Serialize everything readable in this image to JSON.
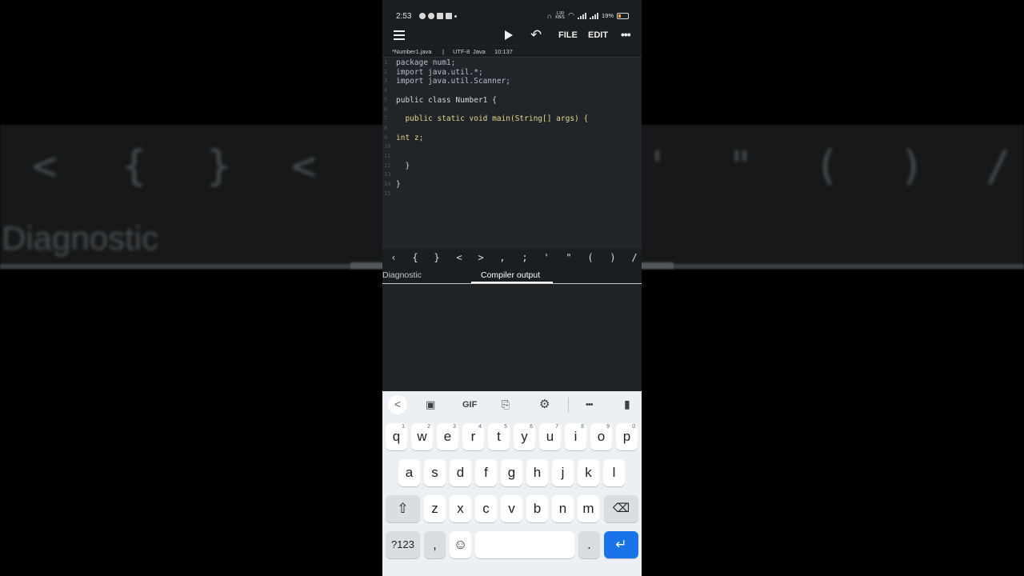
{
  "background": {
    "keys": [
      "<",
      "{",
      "}",
      "<",
      "'",
      "\"",
      "(",
      ")",
      "/"
    ],
    "diagnostic_label": "Diagnostic"
  },
  "status_bar": {
    "time": "2:53",
    "network_speed": "1.00 KB/S",
    "battery": "19%"
  },
  "toolbar": {
    "file_label": "FILE",
    "edit_label": "EDIT",
    "more_label": "•••",
    "undo_glyph": "↶"
  },
  "file_info": {
    "filename": "*Number1.java",
    "separator": "|",
    "encoding": "UTF-8",
    "language": "Java",
    "cursor": "10:137"
  },
  "editor": {
    "lines": [
      {
        "num": "1",
        "code": "package num1;"
      },
      {
        "num": "2",
        "code": "import java.util.*;"
      },
      {
        "num": "3",
        "code": "import java.util.Scanner;"
      },
      {
        "num": "4",
        "code": ""
      },
      {
        "num": "5",
        "code": "public class Number1 {"
      },
      {
        "num": "6",
        "code": ""
      },
      {
        "num": "7",
        "code": "  public static void main(String[] args) {"
      },
      {
        "num": "8",
        "code": ""
      },
      {
        "num": "9",
        "code": "int z;"
      },
      {
        "num": "10",
        "code": ""
      },
      {
        "num": "11",
        "code": ""
      },
      {
        "num": "12",
        "code": "  }"
      },
      {
        "num": "13",
        "code": ""
      },
      {
        "num": "14",
        "code": "}"
      },
      {
        "num": "15",
        "code": ""
      }
    ]
  },
  "symbol_bar": {
    "symbols": [
      "‹",
      "{",
      "}",
      "<",
      ">",
      ",",
      ";",
      "'",
      "\"",
      "(",
      ")",
      "/"
    ]
  },
  "tabs": {
    "diagnostic": "Diagnostic",
    "compiler_output": "Compiler output"
  },
  "keyboard": {
    "toolbar": {
      "back": "<",
      "gif": "GIF",
      "more": "•••"
    },
    "row1": [
      {
        "key": "q",
        "hint": "1"
      },
      {
        "key": "w",
        "hint": "2"
      },
      {
        "key": "e",
        "hint": "3"
      },
      {
        "key": "r",
        "hint": "4"
      },
      {
        "key": "t",
        "hint": "5"
      },
      {
        "key": "y",
        "hint": "6"
      },
      {
        "key": "u",
        "hint": "7"
      },
      {
        "key": "i",
        "hint": "8"
      },
      {
        "key": "o",
        "hint": "9"
      },
      {
        "key": "p",
        "hint": "0"
      }
    ],
    "row2": [
      "a",
      "s",
      "d",
      "f",
      "g",
      "h",
      "j",
      "k",
      "l"
    ],
    "row3": [
      "z",
      "x",
      "c",
      "v",
      "b",
      "n",
      "m"
    ],
    "symbols_key": "?123",
    "comma_key": ",",
    "period_key": ".",
    "shift_glyph": "⇧",
    "backspace_glyph": "⌫",
    "enter_glyph": "↵",
    "emoji_glyph": "☺"
  }
}
